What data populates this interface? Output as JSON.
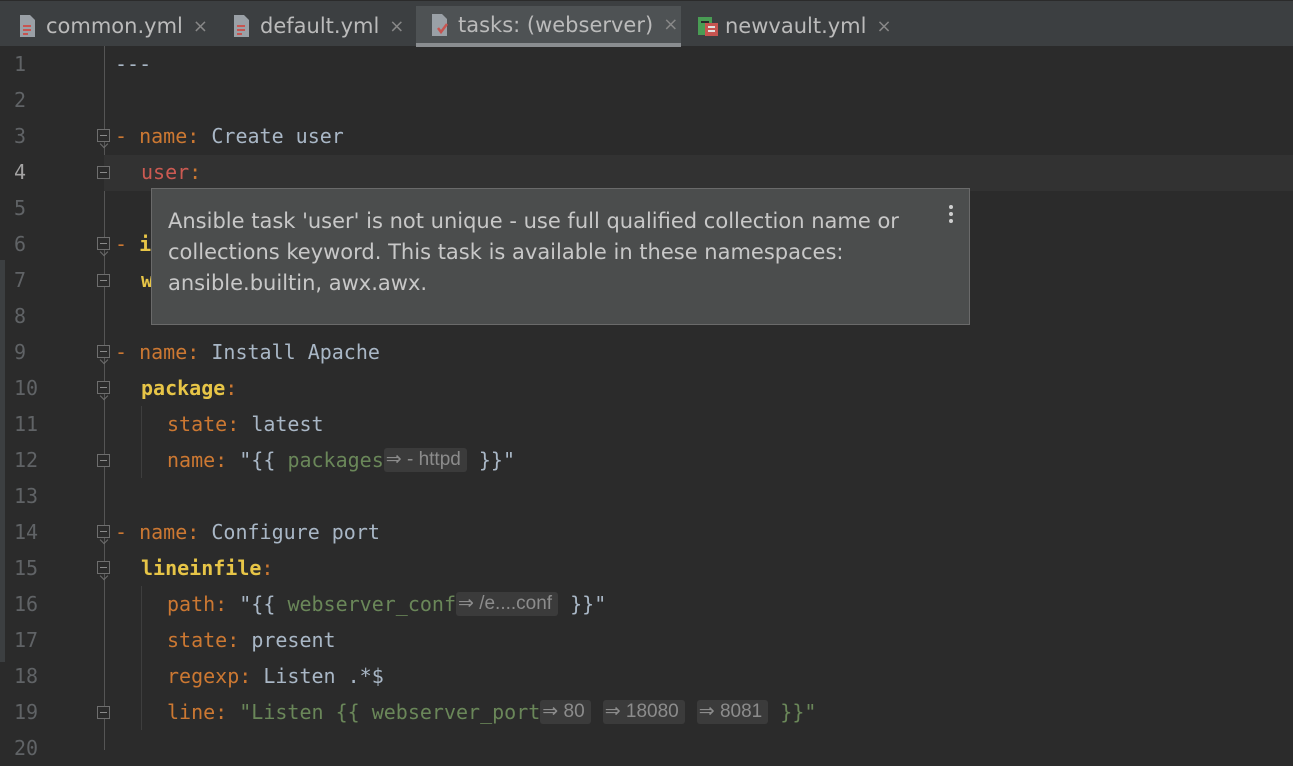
{
  "tabs": [
    {
      "label": "common.yml",
      "icon": "yaml-file-icon",
      "active": false
    },
    {
      "label": "default.yml",
      "icon": "yaml-file-icon",
      "active": false
    },
    {
      "label": "tasks: (webserver)",
      "icon": "ansible-task-file-icon",
      "active": true
    },
    {
      "label": "newvault.yml",
      "icon": "vault-file-icon",
      "active": false
    }
  ],
  "close_glyph": "×",
  "line_numbers": [
    "1",
    "2",
    "3",
    "4",
    "5",
    "6",
    "7",
    "8",
    "9",
    "10",
    "11",
    "12",
    "13",
    "14",
    "15",
    "16",
    "17",
    "18",
    "19",
    "20"
  ],
  "current_line": 4,
  "code": {
    "l1": "---",
    "dash": "- ",
    "name_key": "name",
    "colon": ": ",
    "l3_val": "Create user",
    "l4_key": "user",
    "l6_frag": "i",
    "l7_frag": "w",
    "l9_val": "Install Apache",
    "l10_key": "package",
    "state_key": "state",
    "l11_val": "latest",
    "l12_str_open": "\"{{ ",
    "l12_var": "packages",
    "l12_hint": "⇒ - httpd",
    "l12_str_close": " }}\"",
    "l14_val": "Configure port",
    "l15_key": "lineinfile",
    "path_key": "path",
    "l16_var": "webserver_conf",
    "l16_hint": "⇒ /e....conf",
    "l17_val": "present",
    "regexp_key": "regexp",
    "l18_val": "Listen .*$",
    "line_key": "line",
    "l19_str_open": "\"Listen {{ ",
    "l19_var": "webserver_port",
    "l19_hints": [
      "⇒ 80",
      "⇒ 18080",
      "⇒ 8081"
    ]
  },
  "tooltip": {
    "message": "Ansible task 'user' is not unique - use full qualified collection name or collections keyword. This task is available in these namespaces: ansible.builtin, awx.awx."
  },
  "colors": {
    "background": "#2b2b2b",
    "key_orange": "#cc7832",
    "key_error_red": "#cc5a52",
    "module_yellow": "#e7c547",
    "string_green": "#6a8759",
    "text": "#a9b7c6"
  }
}
